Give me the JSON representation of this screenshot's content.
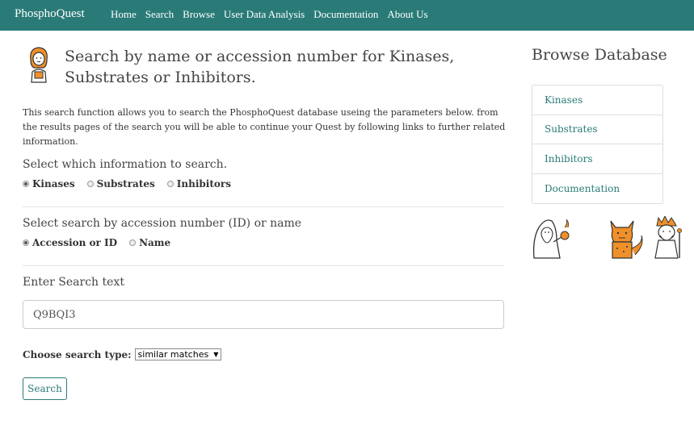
{
  "navbar": {
    "brand": "PhosphoQuest",
    "links": [
      "Home",
      "Search",
      "Browse",
      "User Data Analysis",
      "Documentation",
      "About Us"
    ]
  },
  "main": {
    "title": "Search by name or accession number for Kinases, Substrates or Inhibitors.",
    "intro": "This search function allows you to search the PhosphoQuest database useing the parameters below. from the results pages of the search you will be able to continue your Quest by following links to further related information.",
    "info_section": {
      "label": "Select which information to search.",
      "options": [
        "Kinases",
        "Substrates",
        "Inhibitors"
      ],
      "selected": "Kinases"
    },
    "by_section": {
      "label": "Select search by accession number (ID) or name",
      "options": [
        "Accession or ID",
        "Name"
      ],
      "selected": "Accession or ID"
    },
    "search_text": {
      "label": "Enter Search text",
      "value": "Q9BQI3"
    },
    "search_type": {
      "label": "Choose search type:",
      "selected": "similar matches"
    },
    "search_button": "Search"
  },
  "sidebar": {
    "title": "Browse Database",
    "items": [
      "Kinases",
      "Substrates",
      "Inhibitors",
      "Documentation"
    ]
  },
  "colors": {
    "brand": "#2a7b78",
    "accent_orange": "#f0902a"
  },
  "icons": [
    "hero-character-icon",
    "wizard-icon",
    "fox-creature-icon",
    "king-creature-icon"
  ]
}
